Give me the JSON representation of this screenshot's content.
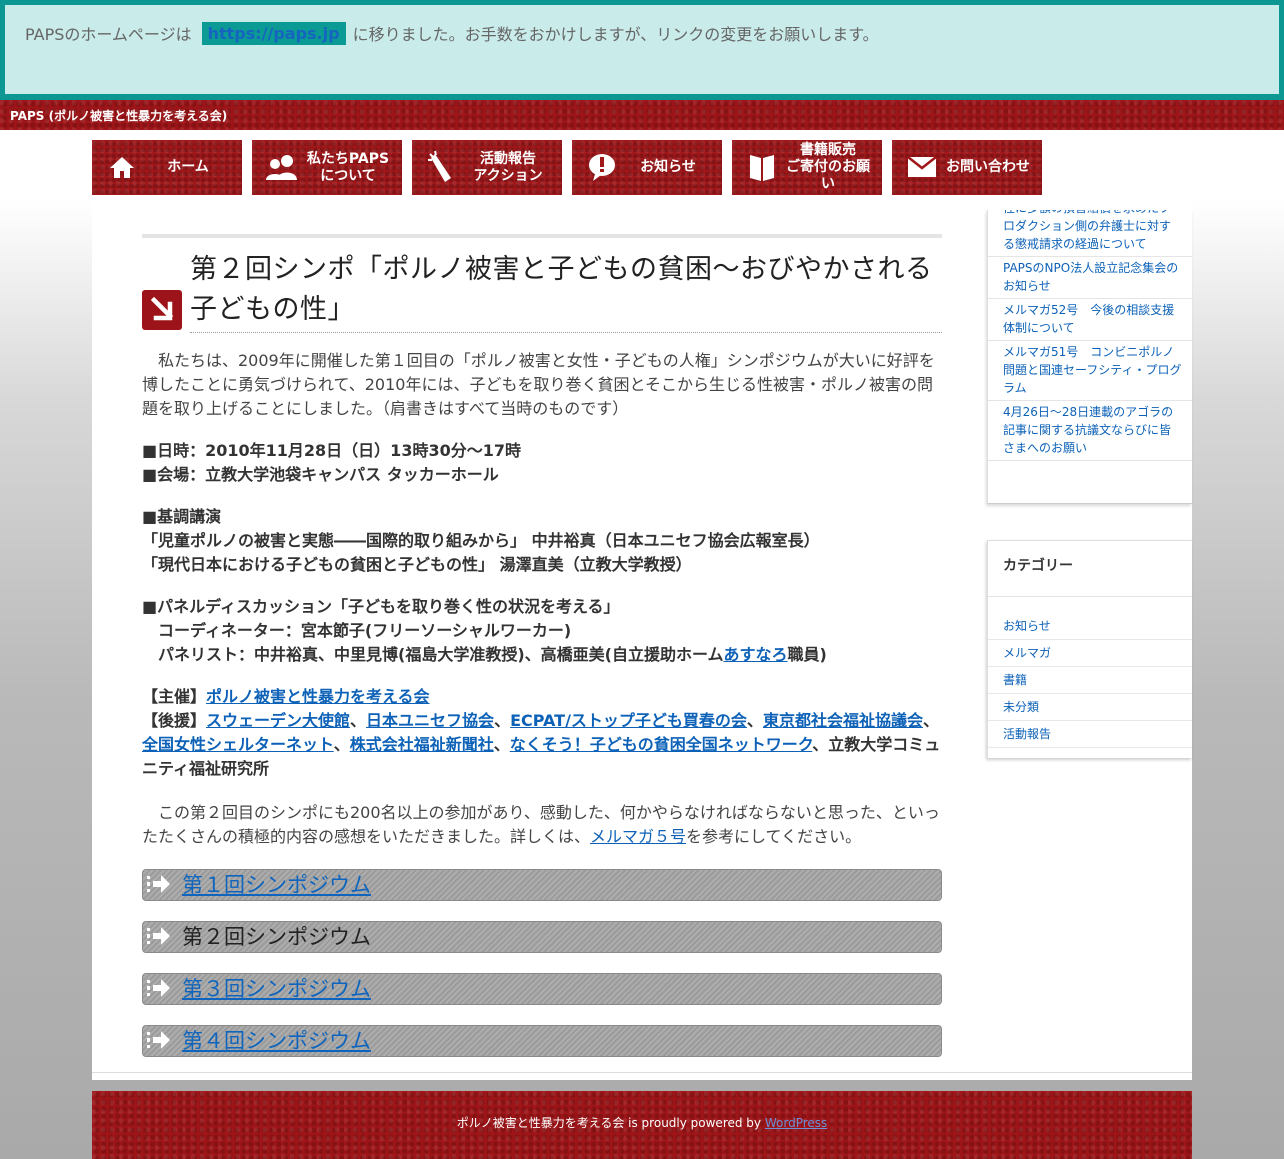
{
  "notice": {
    "before": "PAPSのホームページは",
    "link": "https://paps.jp",
    "after": "に移りました。お手数をおかけしますが、リンクの変更をお願いします。"
  },
  "site": {
    "title": "PAPS (ポルノ被害と性暴力を考える会)"
  },
  "nav": [
    {
      "label": "ホーム",
      "icon": "home-icon"
    },
    {
      "label": "私たちPAPS\nについて",
      "icon": "people-icon"
    },
    {
      "label": "活動報告\nアクション",
      "icon": "megaphone-icon"
    },
    {
      "label": "お知らせ",
      "icon": "exclamation-icon"
    },
    {
      "label": "書籍販売\nご寄付のお願い",
      "icon": "book-icon"
    },
    {
      "label": "お問い合わせ",
      "icon": "mail-icon"
    }
  ],
  "article": {
    "title": "第２回シンポ「ポルノ被害と子どもの貧困～おびやかされる子どもの性」",
    "intro": "私たちは、2009年に開催した第１回目の「ポルノ被害と女性・子どもの人権」シンポジウムが大いに好評を博したことに勇気づけられて、2010年には、子どもを取り巻く貧困とそこから生じる性被害・ポルノ被害の問題を取り上げることにしました。（肩書きはすべて当時のものです）",
    "date": "■日時：2010年11月28日（日）13時30分～17時",
    "venue": "■会場：立教大学池袋キャンパス タッカーホール",
    "keynote_head": "■基調講演",
    "keynote1": "「児童ポルノの被害と実態――国際的取り組みから」 中井裕真（日本ユニセフ協会広報室長）",
    "keynote2": "「現代日本における子どもの貧困と子どもの性」 湯澤直美（立教大学教授）",
    "panel_head": "■パネルディスカッション「子どもを取り巻く性の状況を考える」",
    "coordinator": "コーディネーター：宮本節子(フリーソーシャルワーカー)",
    "panelists_pre": "パネリスト：中井裕真、中里見博(福島大学准教授)、高橋亜美(自立援助ホーム",
    "panelists_link": "あすなろ",
    "panelists_post": "職員)",
    "host_label": "【主催】",
    "host_link": "ポルノ被害と性暴力を考える会",
    "support_label": "【後援】",
    "supporters": [
      "スウェーデン大使館",
      "日本ユニセフ協会",
      "ECPAT/ストップ子ども買春の会",
      "東京都社会福祉協議会",
      "全国女性シェルターネット",
      "株式会社福祉新聞社",
      "なくそう！子どもの貧困全国ネットワーク"
    ],
    "sep": "、",
    "support_tail": "、立教大学コミュニティ福祉研究所",
    "outro_pre": "この第２回目のシンポにも200名以上の参加があり、感動した、何かやらなければならないと思った、といったたくさんの積極的内容の感想をいただきました。詳しくは、",
    "outro_link": "メルマガ５号",
    "outro_post": "を参考にしてください。",
    "symposia": [
      "第１回シンポジウム",
      "第２回シンポジウム",
      "第３回シンポジウム",
      "第４回シンポジウム"
    ]
  },
  "sidebar": {
    "recent": [
      "性に多額の損害賠償を求めたプロダクション側の弁護士に対する懲戒請求の経過について",
      "PAPSのNPO法人設立記念集会のお知らせ",
      "メルマガ52号　今後の相談支援体制について",
      "メルマガ51号　コンビニポルノ問題と国連セーフシティ・プログラム",
      "4月26日〜28日連載のアゴラの記事に関する抗議文ならびに皆さまへのお願い"
    ],
    "category_title": "カテゴリー",
    "categories": [
      "お知らせ",
      "メルマガ",
      "書籍",
      "未分類",
      "活動報告"
    ]
  },
  "footer": {
    "text": "ポルノ被害と性暴力を考える会 is proudly powered by ",
    "link": "WordPress"
  }
}
